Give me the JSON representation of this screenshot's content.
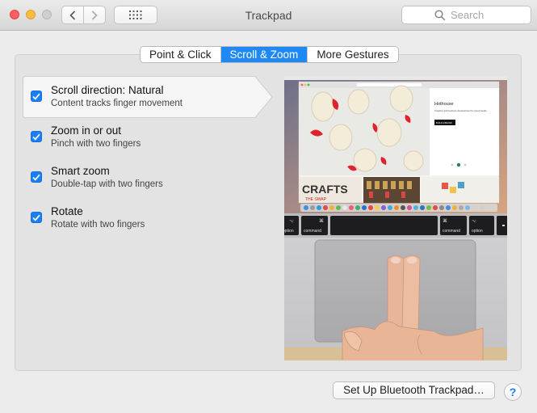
{
  "window": {
    "title": "Trackpad",
    "search_placeholder": "Search"
  },
  "tabs": [
    {
      "label": "Point & Click",
      "active": false
    },
    {
      "label": "Scroll & Zoom",
      "active": true
    },
    {
      "label": "More Gestures",
      "active": false
    }
  ],
  "options": [
    {
      "title": "Scroll direction: Natural",
      "subtitle": "Content tracks finger movement",
      "checked": true,
      "selected": true
    },
    {
      "title": "Zoom in or out",
      "subtitle": "Pinch with two fingers",
      "checked": true,
      "selected": false
    },
    {
      "title": "Smart zoom",
      "subtitle": "Double-tap with two fingers",
      "checked": true,
      "selected": false
    },
    {
      "title": "Rotate",
      "subtitle": "Rotate with two fingers",
      "checked": true,
      "selected": false
    }
  ],
  "preview": {
    "web_heading": "Hothouse",
    "web_body": "Creative and business development for good people.",
    "web_button": "BUILD A BRAND",
    "crafts_title": "CRAFTS",
    "crafts_sub": "THE SWAP",
    "keyboard": {
      "option_left": "option",
      "command_left": "command",
      "command_right": "command",
      "option_right": "option",
      "cmd_symbol": "⌘",
      "alt_symbol": "⌥"
    }
  },
  "footer": {
    "setup_button": "Set Up Bluetooth Trackpad…",
    "help_button": "?"
  },
  "colors": {
    "accent": "#1e88f5",
    "checkbox": "#1a7ff0"
  }
}
